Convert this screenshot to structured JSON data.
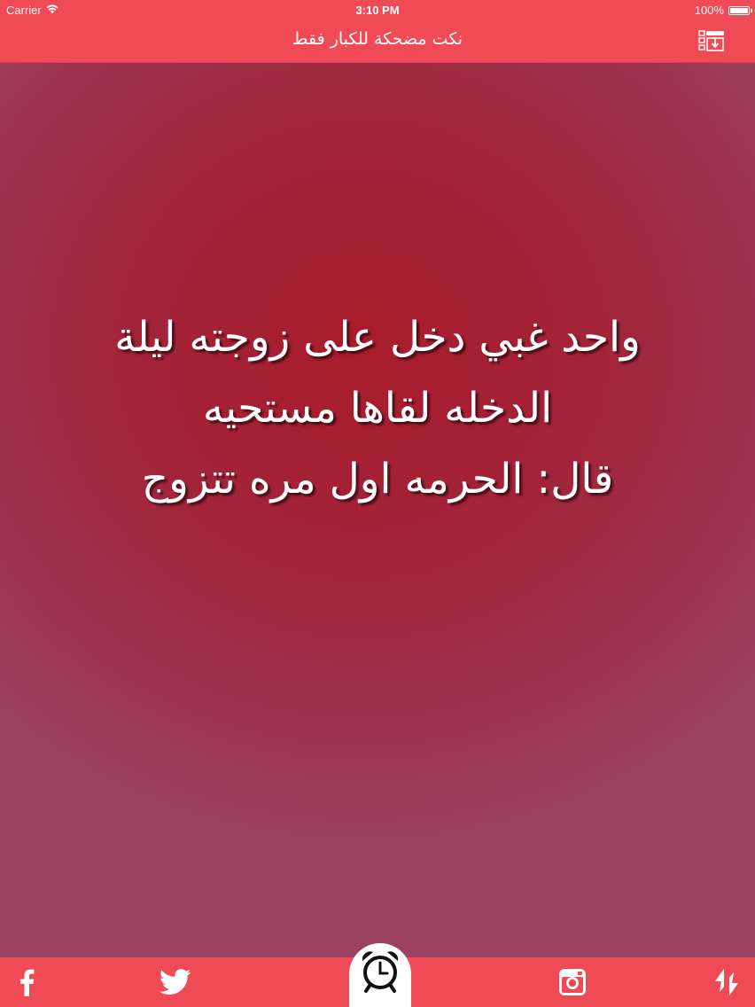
{
  "status_bar": {
    "carrier": "Carrier",
    "time": "3:10 PM",
    "battery": "100%",
    "battery_level": 1.0
  },
  "nav": {
    "title": "نكت مضحكة للكبار فقط",
    "menu_icon": "list-download-icon"
  },
  "joke": {
    "text": "واحد غبي دخل على زوجته ليلة\nالدخله لقاها مستحيه\nقال: الحرمه اول مره تتزوج"
  },
  "bottom_bar": {
    "facebook_icon": "facebook-icon",
    "twitter_icon": "twitter-icon",
    "alarm_icon": "alarm-clock-icon",
    "instagram_icon": "instagram-icon",
    "share_icon": "share-arrows-icon"
  },
  "colors": {
    "accent": "#ef4a55",
    "background": "#a2243a",
    "text": "#ffffff"
  }
}
